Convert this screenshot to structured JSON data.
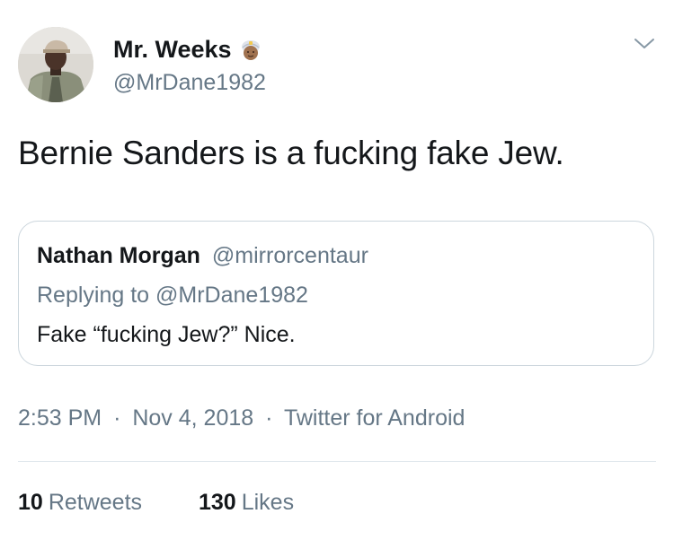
{
  "tweet": {
    "author": {
      "display_name": "Mr. Weeks",
      "handle": "@MrDane1982",
      "badge_icon": "man-with-turban-emoji",
      "avatar": "profile-photo"
    },
    "menu_icon": "chevron-down-icon",
    "text": "Bernie Sanders is a fucking fake Jew.",
    "quoted_tweet": {
      "display_name": "Nathan Morgan",
      "handle": "@mirrorcentaur",
      "replying_to": "Replying to @MrDane1982",
      "text": "Fake “fucking Jew?” Nice."
    },
    "meta": {
      "time": "2:53 PM",
      "separator": "·",
      "date": "Nov 4, 2018",
      "source": "Twitter for Android"
    },
    "stats": {
      "retweets_count": "10",
      "retweets_label": "Retweets",
      "likes_count": "130",
      "likes_label": "Likes"
    }
  },
  "colors": {
    "text_primary": "#14171a",
    "text_secondary": "#657786",
    "border": "#ccd6dd",
    "divider": "#e1e8ed"
  }
}
